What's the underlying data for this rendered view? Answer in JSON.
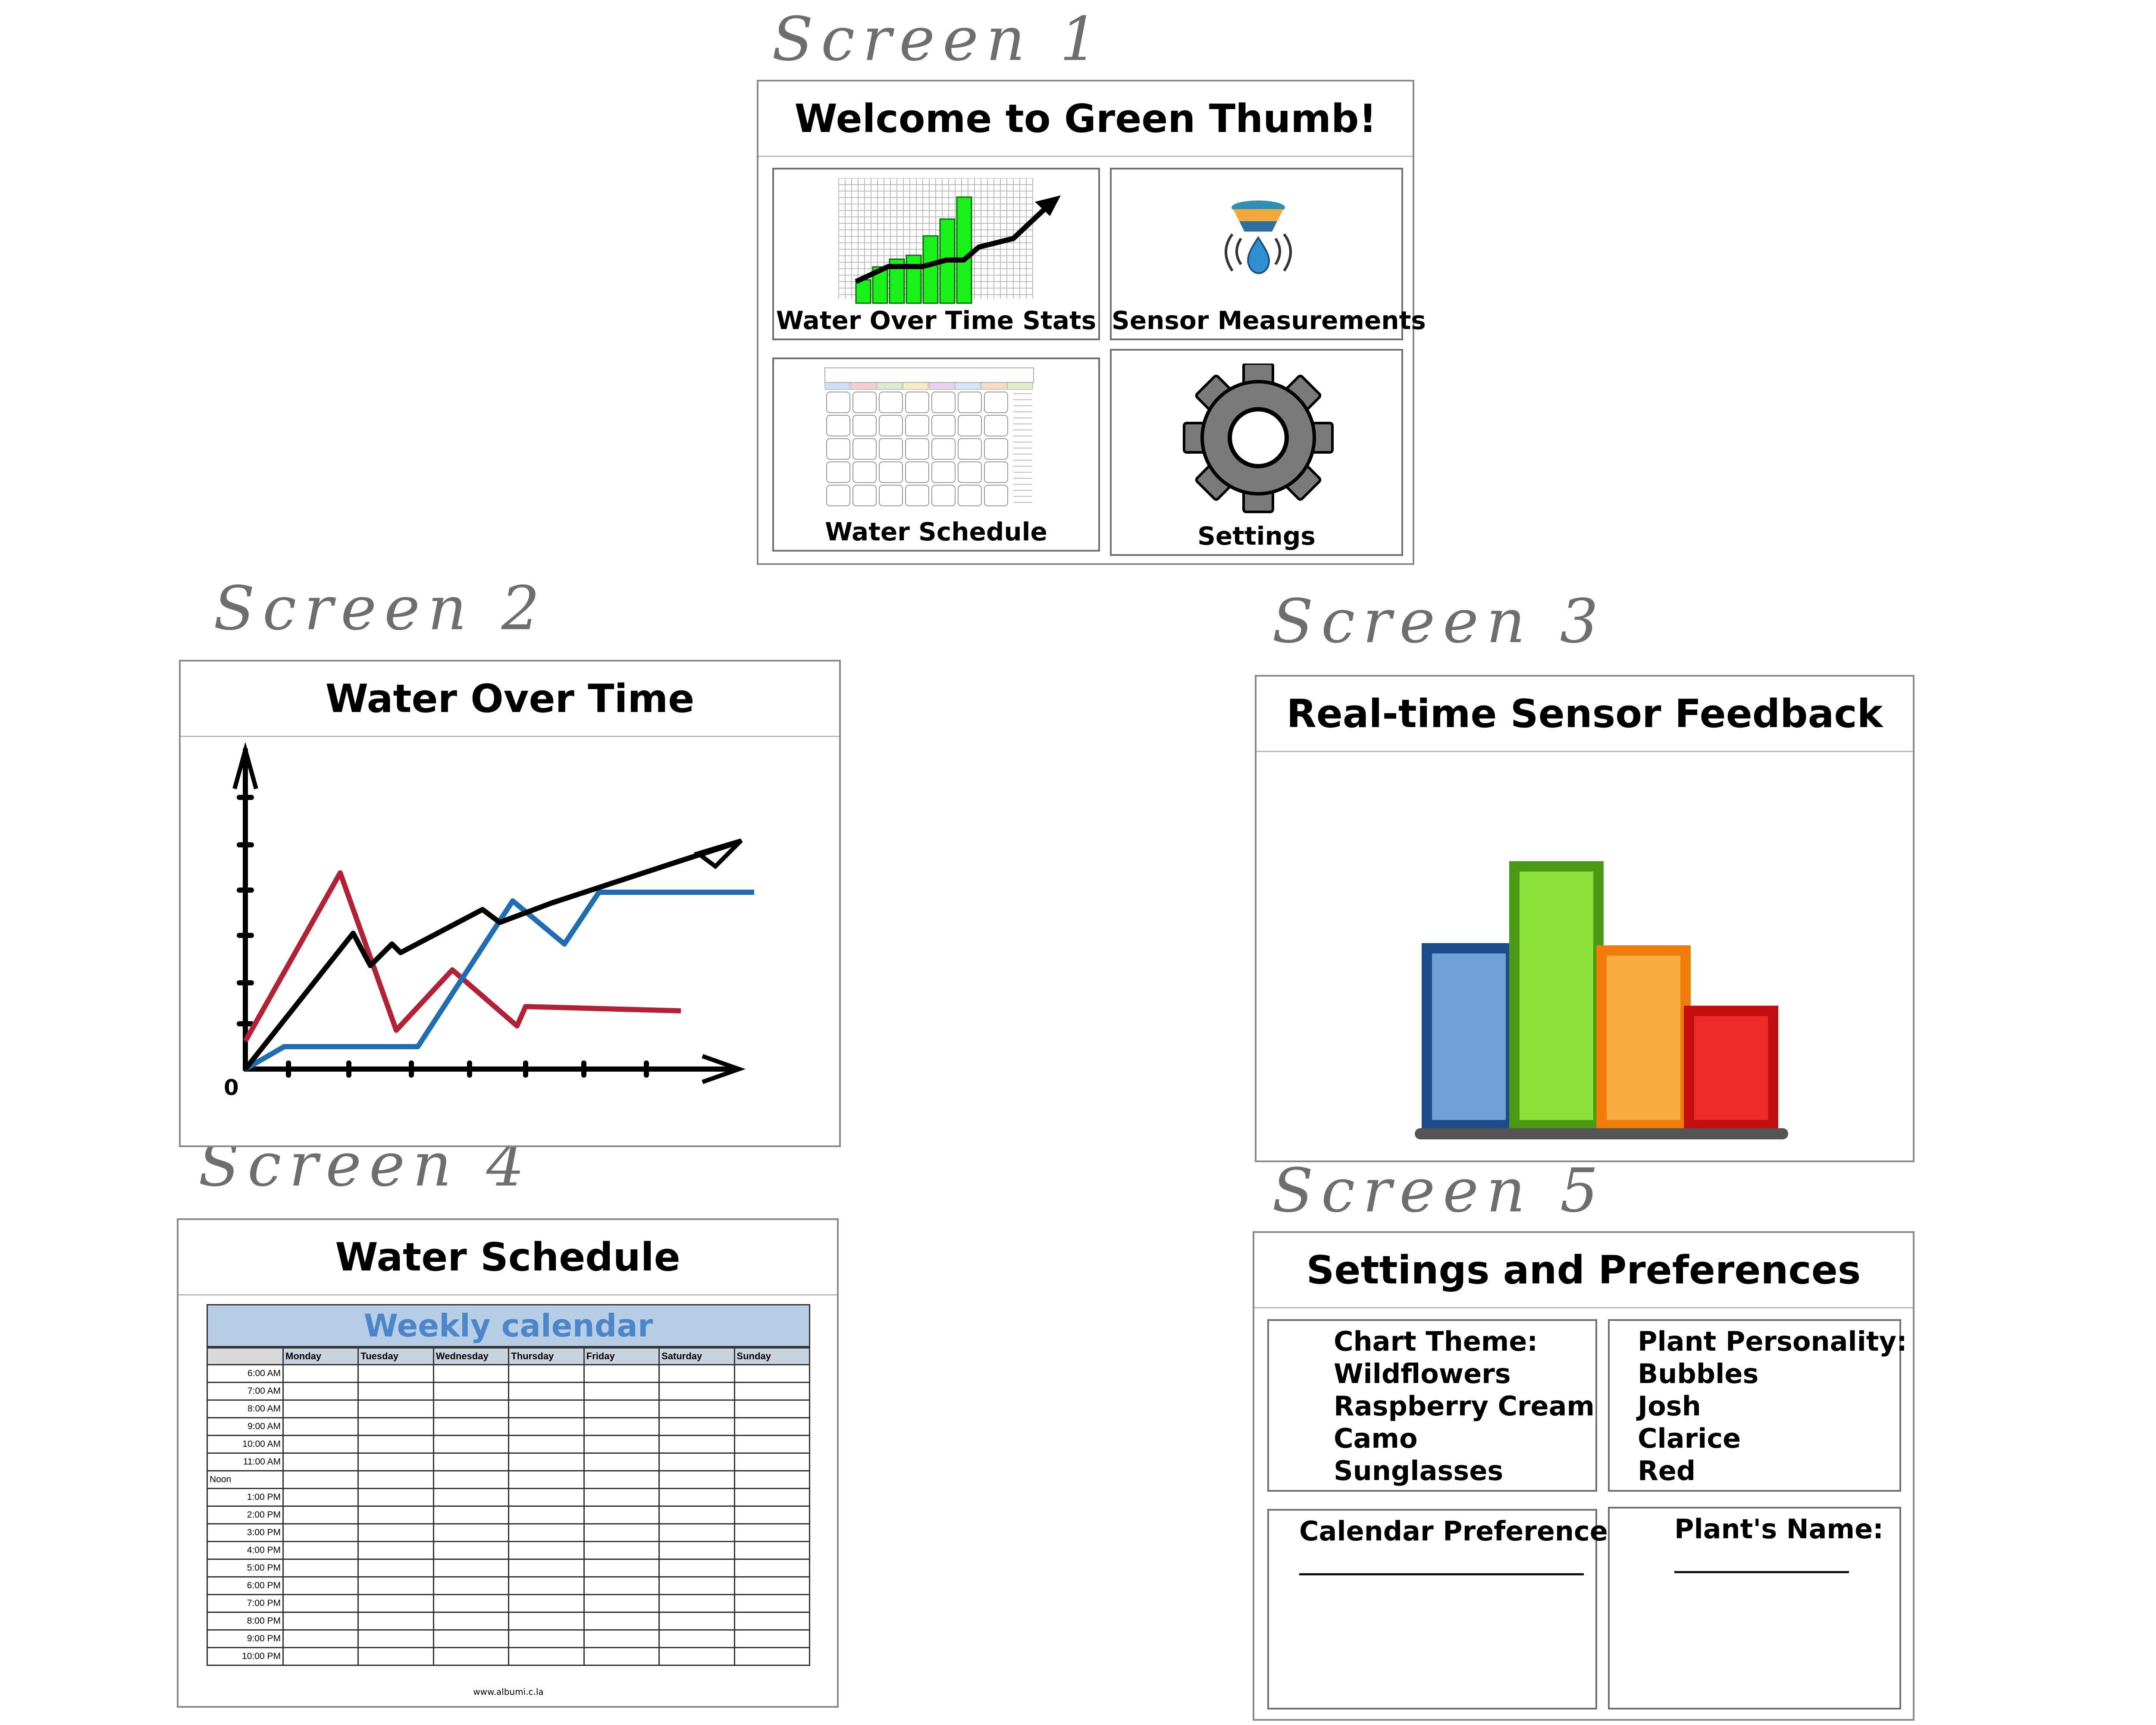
{
  "annotations": {
    "screen1": "Screen 1",
    "screen2": "Screen 2",
    "screen3": "Screen 3",
    "screen4": "Screen 4",
    "screen5": "Screen 5"
  },
  "screen1": {
    "title": "Welcome to Green Thumb!",
    "tiles": {
      "stats": "Water Over Time Stats",
      "sensor": "Sensor Measurements",
      "schedule": "Water Schedule",
      "settings": "Settings"
    },
    "stats_icon_bars": [
      0.18,
      0.28,
      0.34,
      0.37,
      0.52,
      0.65,
      0.82
    ],
    "mini_calendar_days": [
      "Sunday",
      "Monday",
      "Tuesday",
      "Wednesday",
      "Thursday",
      "Friday",
      "Saturday",
      "Notes"
    ]
  },
  "screen2": {
    "title": "Water Over Time",
    "origin_label": "0"
  },
  "screen3": {
    "title": "Real-time Sensor Feedback"
  },
  "screen4": {
    "title": "Water Schedule",
    "calendar_title": "Weekly calendar",
    "days": [
      "Monday",
      "Tuesday",
      "Wednesday",
      "Thursday",
      "Friday",
      "Saturday",
      "Sunday"
    ],
    "times": [
      "6:00 AM",
      "7:00 AM",
      "8:00 AM",
      "9:00 AM",
      "10:00 AM",
      "11:00 AM",
      "Noon",
      "1:00 PM",
      "2:00 PM",
      "3:00 PM",
      "4:00 PM",
      "5:00 PM",
      "6:00 PM",
      "7:00 PM",
      "8:00 PM",
      "9:00 PM",
      "10:00 PM"
    ],
    "footer": "www.albumi.c.la"
  },
  "screen5": {
    "title": "Settings and Preferences",
    "chart_theme": {
      "label": "Chart Theme:",
      "options": [
        "Wildflowers",
        "Raspberry Cream",
        "Camo",
        "Sunglasses"
      ]
    },
    "plant_personality": {
      "label": "Plant Personality:",
      "options": [
        "Bubbles",
        "Josh",
        "Clarice",
        "Red"
      ]
    },
    "calendar_preferences": {
      "label": "Calendar Preferences:"
    },
    "plant_name": {
      "label": "Plant's Name:"
    }
  },
  "colors": {
    "frame": "#8a8a8a",
    "red_line": "#b22234",
    "blue_line": "#1f6db5",
    "bar_blue": "#6fa0d6",
    "bar_green": "#8ce03a",
    "bar_orange": "#f9ad3e",
    "bar_red": "#ee2b2b",
    "calendar_header": "#b7cde6",
    "calendar_title": "#4a86c8"
  }
}
